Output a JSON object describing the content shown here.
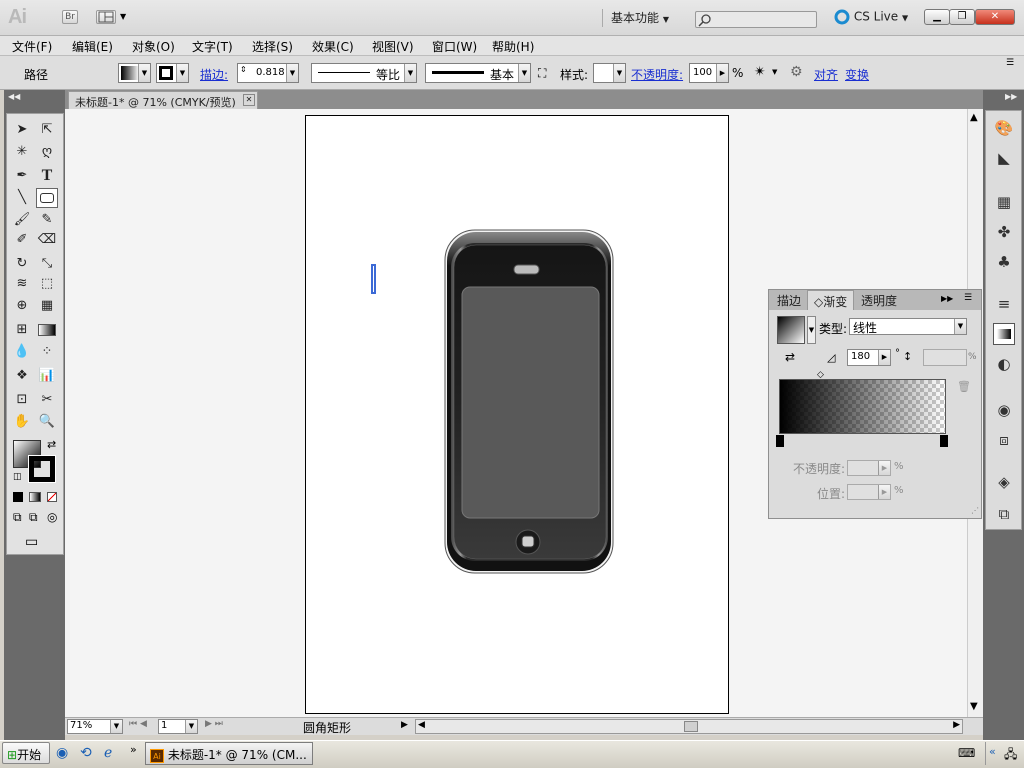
{
  "app": {
    "logo_text": "Ai",
    "bridge_label": "Br",
    "workspace": "基本功能",
    "cs_live": "CS Live"
  },
  "menu": [
    "文件(F)",
    "编辑(E)",
    "对象(O)",
    "文字(T)",
    "选择(S)",
    "效果(C)",
    "视图(V)",
    "窗口(W)",
    "帮助(H)"
  ],
  "control": {
    "mode_label": "路径",
    "stroke_link": "描边:",
    "stroke_value": "0.818 p",
    "profile_label": "等比",
    "brush_label": "基本",
    "style_label": "样式:",
    "opacity_link": "不透明度:",
    "opacity_value": "100",
    "opacity_unit": "%",
    "align_link": "对齐",
    "transform_link": "变换"
  },
  "document": {
    "tab_title": "未标题-1* @ 71% (CMYK/预览)",
    "close_glyph": "✕"
  },
  "gradient_panel": {
    "tabs": [
      "描边",
      "◇渐变",
      "透明度"
    ],
    "type_label": "类型:",
    "type_value": "线性",
    "angle_value": "180",
    "degree_sign": "°",
    "percent_sign": "%",
    "opacity_label": "不透明度:",
    "opacity_unit": "%",
    "position_label": "位置:",
    "position_unit": "%"
  },
  "status": {
    "zoom": "71%",
    "page": "1",
    "tool_name": "圆角矩形"
  },
  "taskbar": {
    "start_label": "开始",
    "task_label": "未标题-1* @ 71% (CM..."
  },
  "colors": {
    "accent_link": "#1a2fd1",
    "panel_bg": "#dcdcdc",
    "dock_bg": "#6a6a6a"
  }
}
